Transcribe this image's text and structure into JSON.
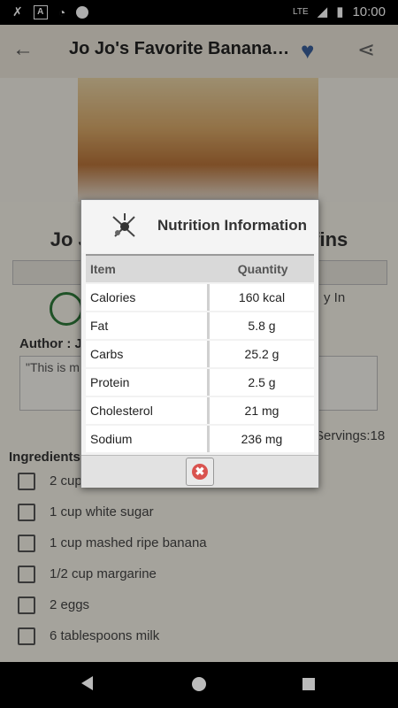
{
  "status_bar": {
    "time": "10:00",
    "network": "LTE"
  },
  "app_bar": {
    "title": "Jo Jo's Favorite Banana Muffins"
  },
  "recipe": {
    "title": "Jo Jo's Favorite Banana Muffins",
    "tab_label": "",
    "ready_text": "y In",
    "author": "Author : J",
    "quote": "\"This is m... since I was in hig... ou enjoy it!\"",
    "servings": "Servings:18",
    "ingredients_title": "Ingredients",
    "ingredients": [
      "2 cup",
      "1 cup white sugar",
      "1 cup mashed ripe banana",
      "1/2 cup margarine",
      "2 eggs",
      "6 tablespoons milk"
    ]
  },
  "dialog": {
    "title": "Nutrition Information",
    "headers": {
      "item": "Item",
      "quantity": "Quantity"
    },
    "rows": [
      {
        "item": "Calories",
        "quantity": "160 kcal"
      },
      {
        "item": "Fat",
        "quantity": "5.8 g"
      },
      {
        "item": "Carbs",
        "quantity": "25.2 g"
      },
      {
        "item": "Protein",
        "quantity": "2.5 g"
      },
      {
        "item": "Cholesterol",
        "quantity": "21 mg"
      },
      {
        "item": "Sodium",
        "quantity": "236 mg"
      }
    ],
    "close_glyph": "✖"
  }
}
